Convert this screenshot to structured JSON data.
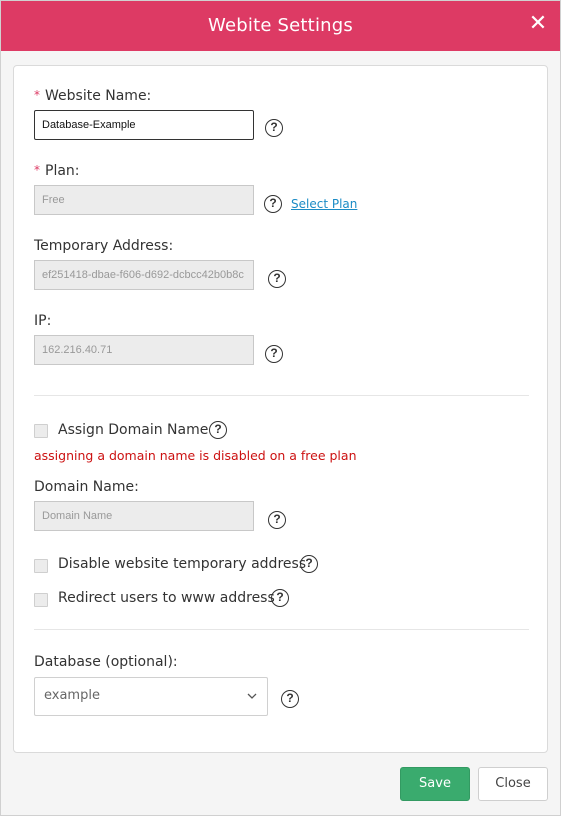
{
  "dialog": {
    "title": "Webite Settings",
    "close_glyph": "✕"
  },
  "form": {
    "website_name": {
      "required_mark": "*",
      "label": "Website Name:",
      "value": "Database-Example"
    },
    "plan": {
      "required_mark": "*",
      "label": "Plan:",
      "value": "Free",
      "select_link": "Select Plan"
    },
    "temp_address": {
      "label": "Temporary Address:",
      "value": "ef251418-dbae-f606-d692-dcbcc42b0b8c"
    },
    "ip": {
      "label": "IP:",
      "value": "162.216.40.71"
    },
    "assign_domain": {
      "label": "Assign Domain Name",
      "checked": false,
      "error": "assigning a domain name is disabled on a free plan"
    },
    "domain_name": {
      "label": "Domain Name:",
      "placeholder": "Domain Name"
    },
    "disable_temp": {
      "label": "Disable website temporary address",
      "checked": false
    },
    "redirect_www": {
      "label": "Redirect users to www address",
      "checked": false
    },
    "database": {
      "label": "Database (optional):",
      "selected": "example"
    },
    "help_glyph": "?"
  },
  "footer": {
    "save_label": "Save",
    "close_label": "Close"
  },
  "colors": {
    "header": "#dd3a64",
    "save": "#3aab6e",
    "error": "#cc1111",
    "link": "#1a8bc5"
  }
}
